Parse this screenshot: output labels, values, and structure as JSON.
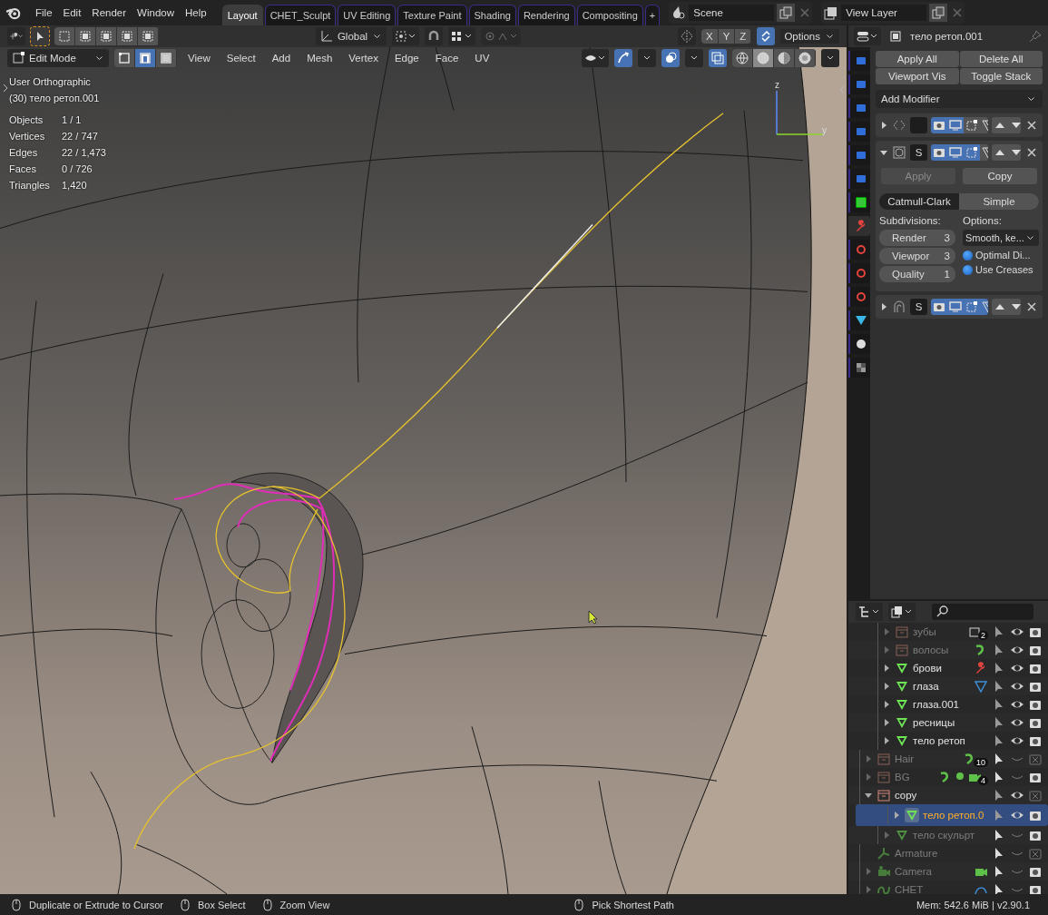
{
  "topbar": {
    "menus": [
      "File",
      "Edit",
      "Render",
      "Window",
      "Help"
    ],
    "workspaces": [
      {
        "label": "Layout",
        "selected": true
      },
      {
        "label": "CHET_Sculpt",
        "selected": false
      },
      {
        "label": "UV Editing",
        "selected": false
      },
      {
        "label": "Texture Paint",
        "selected": false
      },
      {
        "label": "Shading",
        "selected": false
      },
      {
        "label": "Rendering",
        "selected": false
      },
      {
        "label": "Compositing",
        "selected": false
      }
    ],
    "add_tab": "+",
    "scene": "Scene",
    "view_layer": "View Layer"
  },
  "viewport": {
    "orientation": "Global",
    "axis_toggles": [
      {
        "label": "X",
        "on": false
      },
      {
        "label": "Y",
        "on": false
      },
      {
        "label": "Z",
        "on": false
      }
    ],
    "options": "Options",
    "mode": "Edit Mode",
    "select_modes": [
      {
        "selected": false
      },
      {
        "selected": true
      },
      {
        "selected": false
      }
    ],
    "menus": [
      "View",
      "Select",
      "Add",
      "Mesh",
      "Vertex",
      "Edge",
      "Face",
      "UV"
    ],
    "shading": [
      {
        "selected": false
      },
      {
        "selected": true
      },
      {
        "selected": false
      },
      {
        "selected": false
      }
    ],
    "view_name": "User Orthographic",
    "object_line": "(30) тело ретоп.001",
    "stats": [
      {
        "label": "Objects",
        "value": "1 / 1"
      },
      {
        "label": "Vertices",
        "value": "22 / 747"
      },
      {
        "label": "Edges",
        "value": "22 / 1,473"
      },
      {
        "label": "Faces",
        "value": "0 / 726"
      },
      {
        "label": "Triangles",
        "value": "1,420"
      }
    ],
    "gizmo_axes": [
      "z",
      "y"
    ]
  },
  "properties": {
    "object_name": "тело ретоп.001",
    "tabs": [
      {
        "selected": false
      },
      {
        "selected": false
      },
      {
        "selected": false
      },
      {
        "selected": false
      },
      {
        "selected": false
      },
      {
        "selected": false
      },
      {
        "selected": false
      },
      {
        "selected": true
      },
      {
        "selected": false
      },
      {
        "selected": false
      },
      {
        "selected": false
      },
      {
        "selected": false
      },
      {
        "selected": false
      },
      {
        "selected": false
      }
    ],
    "stack_buttons": [
      "Apply All",
      "Delete All",
      "Viewport Vis",
      "Toggle Stack"
    ],
    "add_modifier": "Add Modifier",
    "modifiers": [
      {
        "kind": "mirror",
        "expanded": false,
        "toggles": [
          {
            "on": true
          },
          {
            "on": true
          },
          {
            "on": false
          },
          {
            "on": false
          }
        ]
      },
      {
        "kind": "subdivision",
        "name": "S",
        "expanded": true,
        "toggles": [
          {
            "on": true
          },
          {
            "on": true
          },
          {
            "on": true
          },
          {
            "on": false
          }
        ],
        "apply": {
          "label": "Apply",
          "disabled": true
        },
        "copy": {
          "label": "Copy",
          "disabled": false
        },
        "types": [
          {
            "label": "Catmull-Clark",
            "selected": false
          },
          {
            "label": "Simple",
            "selected": true
          }
        ],
        "subdivisions_label": "Subdivisions:",
        "options_label": "Options:",
        "fields": [
          {
            "label": "Render",
            "value": "3"
          },
          {
            "label": "Viewpor",
            "value": "3"
          },
          {
            "label": "Quality",
            "value": "1"
          }
        ],
        "uv_smooth": "Smooth, ke...",
        "checks": [
          {
            "label": "Optimal Di...",
            "checked": true
          },
          {
            "label": "Use Creases",
            "checked": true
          }
        ]
      },
      {
        "kind": "shrinkwrap",
        "name": "S",
        "expanded": false,
        "toggles": [
          {
            "on": true
          },
          {
            "on": true
          },
          {
            "on": true
          },
          {
            "on": true
          }
        ]
      }
    ]
  },
  "outliner": {
    "scrolled_branch": [
      {
        "name": "зубы",
        "kind": "collection",
        "dimmed": true,
        "selected": false,
        "expanded": false,
        "visible": true,
        "renderable": true,
        "extras": [
          {
            "kind": "collection"
          }
        ],
        "count": "2"
      },
      {
        "name": "волосы",
        "kind": "collection",
        "dimmed": true,
        "selected": false,
        "expanded": false,
        "visible": true,
        "renderable": true,
        "extras": [
          {
            "kind": "hair"
          }
        ]
      },
      {
        "name": "брови",
        "kind": "mesh",
        "dimmed": false,
        "selected": false,
        "expanded": false,
        "visible": true,
        "renderable": true,
        "extras": [
          {
            "kind": "wrench"
          }
        ]
      },
      {
        "name": "глаза",
        "kind": "mesh",
        "dimmed": false,
        "selected": false,
        "expanded": false,
        "visible": true,
        "renderable": true,
        "extras": [
          {
            "kind": "mesh-data"
          }
        ]
      },
      {
        "name": "глаза.001",
        "kind": "mesh",
        "dimmed": false,
        "selected": false,
        "expanded": false,
        "visible": true,
        "renderable": true
      },
      {
        "name": "ресницы",
        "kind": "mesh",
        "dimmed": false,
        "selected": false,
        "expanded": false,
        "visible": true,
        "renderable": true
      },
      {
        "name": "тело ретоп",
        "kind": "mesh",
        "dimmed": false,
        "selected": false,
        "expanded": false,
        "visible": true,
        "renderable": true
      }
    ],
    "items": [
      {
        "name": "Hair",
        "kind": "collection",
        "dimmed": true,
        "selected": false,
        "expanded": false,
        "visible": false,
        "renderable": false,
        "extras": [
          {
            "kind": "hair"
          }
        ],
        "count": "10"
      },
      {
        "name": "BG",
        "kind": "collection",
        "dimmed": true,
        "selected": false,
        "expanded": false,
        "visible": false,
        "renderable": true,
        "extras": [
          {
            "kind": "hair"
          },
          {
            "kind": "light"
          },
          {
            "kind": "camera-data"
          }
        ],
        "count": "4"
      },
      {
        "name": "copy",
        "kind": "collection",
        "dimmed": false,
        "selected": false,
        "expanded": true,
        "visible": true,
        "renderable": false,
        "children": [
          {
            "name": "тело ретоп.0",
            "kind": "mesh",
            "dimmed": false,
            "selected": true,
            "expanded": false,
            "visible": true,
            "renderable": true
          },
          {
            "name": "тело скульрт",
            "kind": "mesh",
            "dimmed": true,
            "selected": false,
            "expanded": false,
            "visible": false,
            "renderable": true
          }
        ]
      },
      {
        "name": "Armature",
        "kind": "armature",
        "dimmed": true,
        "selected": false,
        "visible": false,
        "renderable": false
      },
      {
        "name": "Camera",
        "kind": "camera",
        "dimmed": true,
        "selected": false,
        "expanded": false,
        "visible": false,
        "renderable": true,
        "extras": [
          {
            "kind": "camera-data"
          }
        ]
      },
      {
        "name": "CHET",
        "kind": "curve",
        "dimmed": true,
        "selected": false,
        "expanded": false,
        "visible": false,
        "renderable": true,
        "extras": [
          {
            "kind": "curve-data"
          }
        ]
      }
    ]
  },
  "status_bar": {
    "hints": [
      "Duplicate or Extrude to Cursor",
      "Box Select",
      "Zoom View",
      "Pick Shortest Path"
    ],
    "info": "Mem: 542.6 MiB | v2.90.1"
  }
}
